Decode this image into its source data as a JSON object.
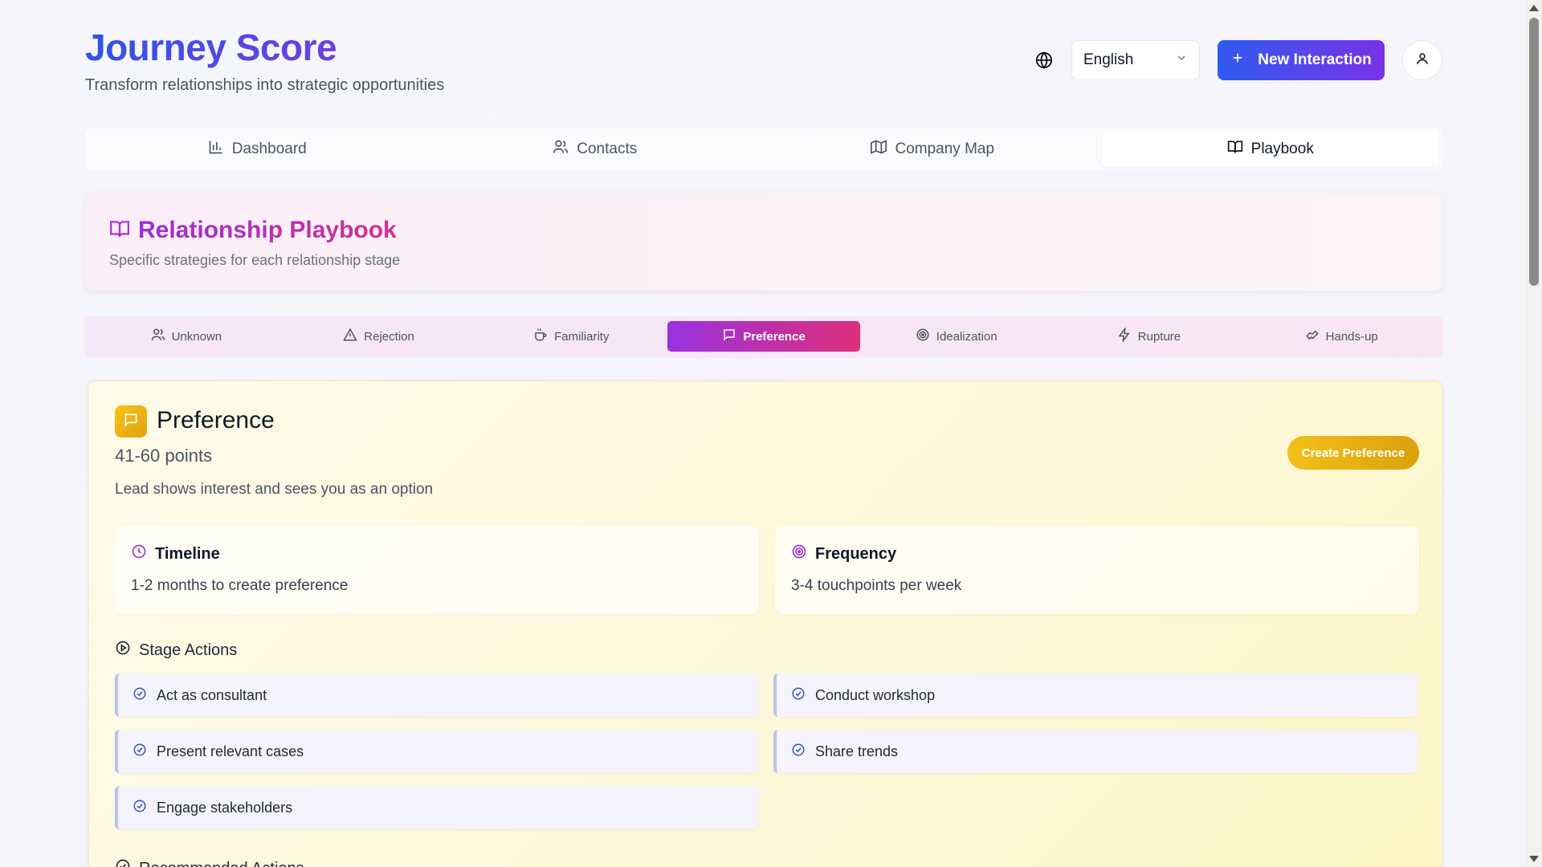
{
  "header": {
    "title": "Journey Score",
    "subtitle": "Transform relationships into strategic opportunities",
    "language": "English",
    "new_button": "New Interaction"
  },
  "main_tabs": [
    {
      "label": "Dashboard",
      "icon": "bar-chart-icon"
    },
    {
      "label": "Contacts",
      "icon": "users-icon"
    },
    {
      "label": "Company Map",
      "icon": "map-icon"
    },
    {
      "label": "Playbook",
      "icon": "book-open-icon",
      "active": true
    }
  ],
  "playbook": {
    "title": "Relationship Playbook",
    "subtitle": "Specific strategies for each relationship stage"
  },
  "stage_tabs": [
    {
      "label": "Unknown",
      "icon": "users-icon"
    },
    {
      "label": "Rejection",
      "icon": "alert-triangle-icon"
    },
    {
      "label": "Familiarity",
      "icon": "coffee-icon"
    },
    {
      "label": "Preference",
      "icon": "message-square-icon",
      "active": true
    },
    {
      "label": "Idealization",
      "icon": "target-icon"
    },
    {
      "label": "Rupture",
      "icon": "zap-icon"
    },
    {
      "label": "Hands-up",
      "icon": "handshake-icon"
    }
  ],
  "stage": {
    "name": "Preference",
    "points": "41-60 points",
    "description": "Lead shows interest and sees you as an option",
    "create_button": "Create Preference",
    "timeline": {
      "title": "Timeline",
      "value": "1-2 months to create preference"
    },
    "frequency": {
      "title": "Frequency",
      "value": "3-4 touchpoints per week"
    },
    "stage_actions_title": "Stage Actions",
    "actions": [
      "Act as consultant",
      "Conduct workshop",
      "Present relevant cases",
      "Share trends",
      "Engage stakeholders"
    ],
    "recommended_title": "Recommended Actions"
  },
  "colors": {
    "accent_blue": "#2f54eb",
    "accent_purple": "#9b2fd6",
    "accent_pink": "#dc2f7a",
    "stage_yellow": "#f2c01a"
  }
}
